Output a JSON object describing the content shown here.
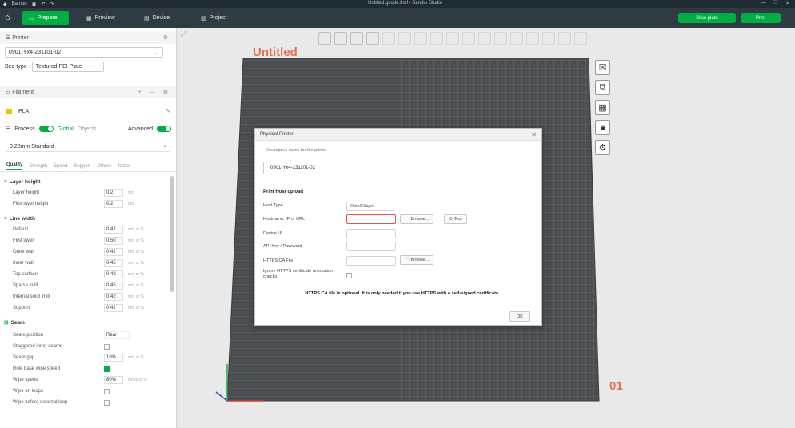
{
  "titlebar": {
    "app_menu": "Bambu",
    "window_title": "Untitled.gcode.3mf - Bambu Studio"
  },
  "tabs": {
    "prepare": "Prepare",
    "preview": "Preview",
    "device": "Device",
    "project": "Project",
    "slice_plate": "Slice plate",
    "print": "Print"
  },
  "left": {
    "printer_section": "Printer",
    "printer_name": "0901-Yx4-231101-02",
    "bed_type_label": "Bed type",
    "bed_type_value": "Textured PEI Plate",
    "filament_section": "Filament",
    "filament_name": "PLA",
    "process_section": "Process",
    "global_label": "Global",
    "objects_label": "Objects",
    "advanced_label": "Advanced",
    "process_preset": "0.20mm Standard",
    "subtabs": [
      "Quality",
      "Strength",
      "Speed",
      "Support",
      "Others",
      "Notes"
    ],
    "groups": {
      "layer_height": "Layer height",
      "line_width": "Line width",
      "seam": "Seam"
    },
    "layer_params": [
      {
        "label": "Layer height",
        "value": "0.2",
        "unit": "mm"
      },
      {
        "label": "First layer height",
        "value": "0.2",
        "unit": "mm"
      }
    ],
    "line_params": [
      {
        "label": "Default",
        "value": "0.42",
        "unit": "mm or %"
      },
      {
        "label": "First layer",
        "value": "0.50",
        "unit": "mm or %"
      },
      {
        "label": "Outer wall",
        "value": "0.42",
        "unit": "mm or %"
      },
      {
        "label": "Inner wall",
        "value": "0.45",
        "unit": "mm or %"
      },
      {
        "label": "Top surface",
        "value": "0.42",
        "unit": "mm or %"
      },
      {
        "label": "Sparse infill",
        "value": "0.45",
        "unit": "mm or %"
      },
      {
        "label": "Internal solid infill",
        "value": "0.42",
        "unit": "mm or %"
      },
      {
        "label": "Support",
        "value": "0.42",
        "unit": "mm or %"
      }
    ],
    "seam_params": [
      {
        "label": "Seam position",
        "value": "Rear",
        "unit": ""
      },
      {
        "label": "Staggered inner seams",
        "value": "",
        "unit": ""
      },
      {
        "label": "Seam gap",
        "value": "10%",
        "unit": "mm or %"
      },
      {
        "label": "Role base wipe speed",
        "value": "",
        "unit": ""
      },
      {
        "label": "Wipe speed",
        "value": "80%",
        "unit": "mm/s or %"
      },
      {
        "label": "Wipe on loops",
        "value": "",
        "unit": ""
      },
      {
        "label": "Wipe before external loop",
        "value": "",
        "unit": ""
      }
    ]
  },
  "viewport": {
    "plate_title": "Untitled",
    "plate_number": "01"
  },
  "dialog": {
    "title": "Physical Printer",
    "subtitle": "Descriptive name for the printer",
    "printer_name_value": "0901-Yx4-231101-02",
    "section_title": "Print Host upload",
    "host_type_label": "Host Type",
    "host_type_value": "Octo/Klipper",
    "hostname_label": "Hostname, IP or URL",
    "browse_label": "Browse...",
    "test_label": "Test",
    "device_ui_label": "Device UI",
    "api_key_label": "API Key / Password",
    "https_ca_label": "HTTPS CA File",
    "https_browse_label": "Browse...",
    "ignore_ssl_label": "Ignore HTTPS certificate revocation checks",
    "note": "HTTPS CA file is optional. It is only needed if you use HTTPS with a self-signed certificate.",
    "ok_label": "OK"
  },
  "colors": {
    "accent": "#00ae42",
    "topbar": "#2d3b42",
    "titlebar": "#1f2b31",
    "plate_label": "#e07055",
    "error_border": "#e35353"
  }
}
